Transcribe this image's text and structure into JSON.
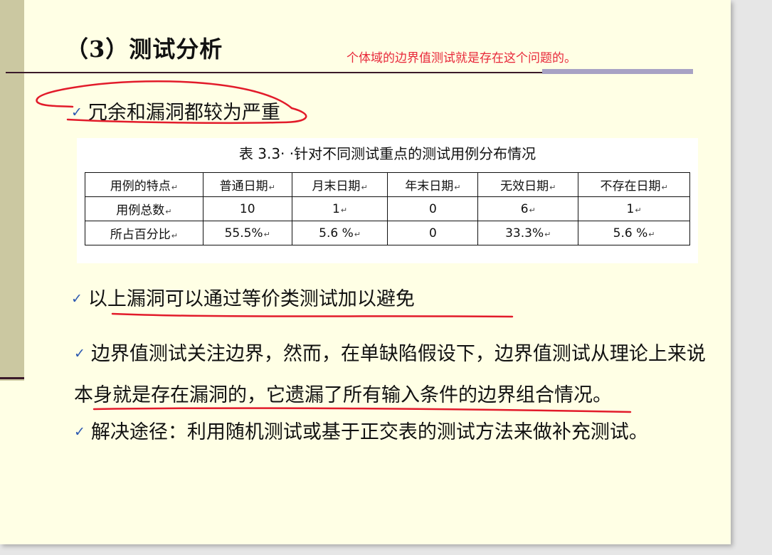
{
  "slide": {
    "title": "（3）测试分析",
    "annotation": "个体域的边界值测试就是存在这个问题的。",
    "bullets": [
      "冗余和漏洞都较为严重",
      "以上漏洞可以通过等价类测试加以避免",
      "边界值测试关注边界，然而，在单缺陷假设下，边界值测试从理论上来说本身就是存在漏洞的，它遗漏了所有输入条件的边界组合情况。",
      "解决途径：利用随机测试或基于正交表的测试方法来做补充测试。"
    ],
    "check_glyph": "✓",
    "table": {
      "caption": "表 3.3· ·针对不同测试重点的测试用例分布情况",
      "headers": [
        "用例的特点",
        "普通日期",
        "月末日期",
        "年末日期",
        "无效日期",
        "不存在日期"
      ],
      "rows": [
        [
          "用例总数",
          "10",
          "1",
          "0",
          "6",
          "1"
        ],
        [
          "所占百分比",
          "55.5%",
          "5.6 %",
          "0",
          "33.3%",
          "5.6 %"
        ]
      ],
      "return_mark": "↵"
    }
  },
  "colors": {
    "slide_bg": "#ffffe5",
    "left_band": "#cbc8a1",
    "annotation": "#e8283a",
    "check": "#2a57b0",
    "ink": "#e21b2a"
  }
}
